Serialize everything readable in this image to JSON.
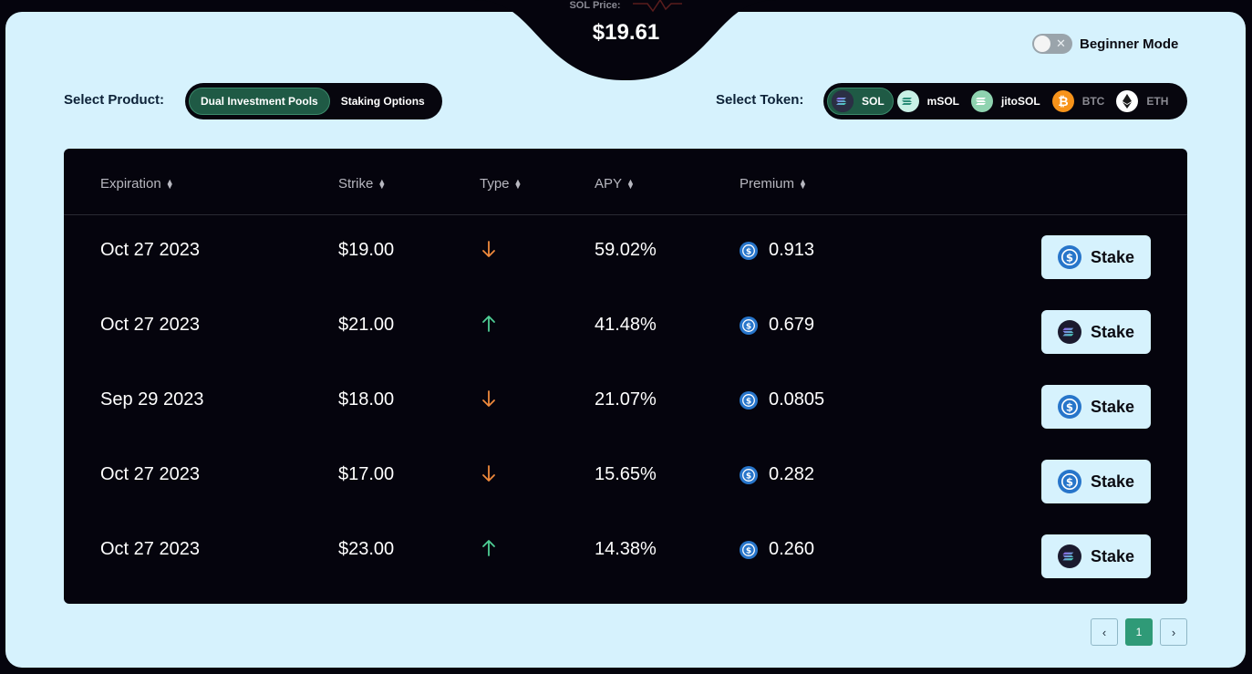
{
  "header": {
    "price_label": "SOL Price:",
    "price_value": "$19.61"
  },
  "beginner_mode": {
    "label": "Beginner Mode",
    "enabled": false
  },
  "product": {
    "label": "Select Product:",
    "options": [
      "Dual Investment Pools",
      "Staking Options"
    ],
    "selected": "Dual Investment Pools"
  },
  "token": {
    "label": "Select Token:",
    "options": [
      {
        "symbol": "SOL",
        "icon": "solana-icon",
        "active": true
      },
      {
        "symbol": "mSOL",
        "icon": "msol-icon",
        "active": false
      },
      {
        "symbol": "jitoSOL",
        "icon": "jitosol-icon",
        "active": false
      },
      {
        "symbol": "BTC",
        "icon": "bitcoin-icon",
        "active": false
      },
      {
        "symbol": "ETH",
        "icon": "ethereum-icon",
        "active": false
      }
    ]
  },
  "table": {
    "columns": [
      "Expiration",
      "Strike",
      "Type",
      "APY",
      "Premium"
    ],
    "rows": [
      {
        "expiration": "Oct 27 2023",
        "strike": "$19.00",
        "type": "down",
        "apy": "59.02%",
        "premium": "0.913",
        "stake_label": "Stake",
        "stake_icon": "usdc-icon"
      },
      {
        "expiration": "Oct 27 2023",
        "strike": "$21.00",
        "type": "up",
        "apy": "41.48%",
        "premium": "0.679",
        "stake_label": "Stake",
        "stake_icon": "solana-icon"
      },
      {
        "expiration": "Sep 29 2023",
        "strike": "$18.00",
        "type": "down",
        "apy": "21.07%",
        "premium": "0.0805",
        "stake_label": "Stake",
        "stake_icon": "usdc-icon"
      },
      {
        "expiration": "Oct 27 2023",
        "strike": "$17.00",
        "type": "down",
        "apy": "15.65%",
        "premium": "0.282",
        "stake_label": "Stake",
        "stake_icon": "usdc-icon"
      },
      {
        "expiration": "Oct 27 2023",
        "strike": "$23.00",
        "type": "up",
        "apy": "14.38%",
        "premium": "0.260",
        "stake_label": "Stake",
        "stake_icon": "solana-icon"
      }
    ]
  },
  "pagination": {
    "current": "1"
  },
  "colors": {
    "panel": "#d6f2fd",
    "dark": "#05040d",
    "accent": "#2f9a77",
    "down": "#f08a3c",
    "up": "#4fcf95"
  }
}
